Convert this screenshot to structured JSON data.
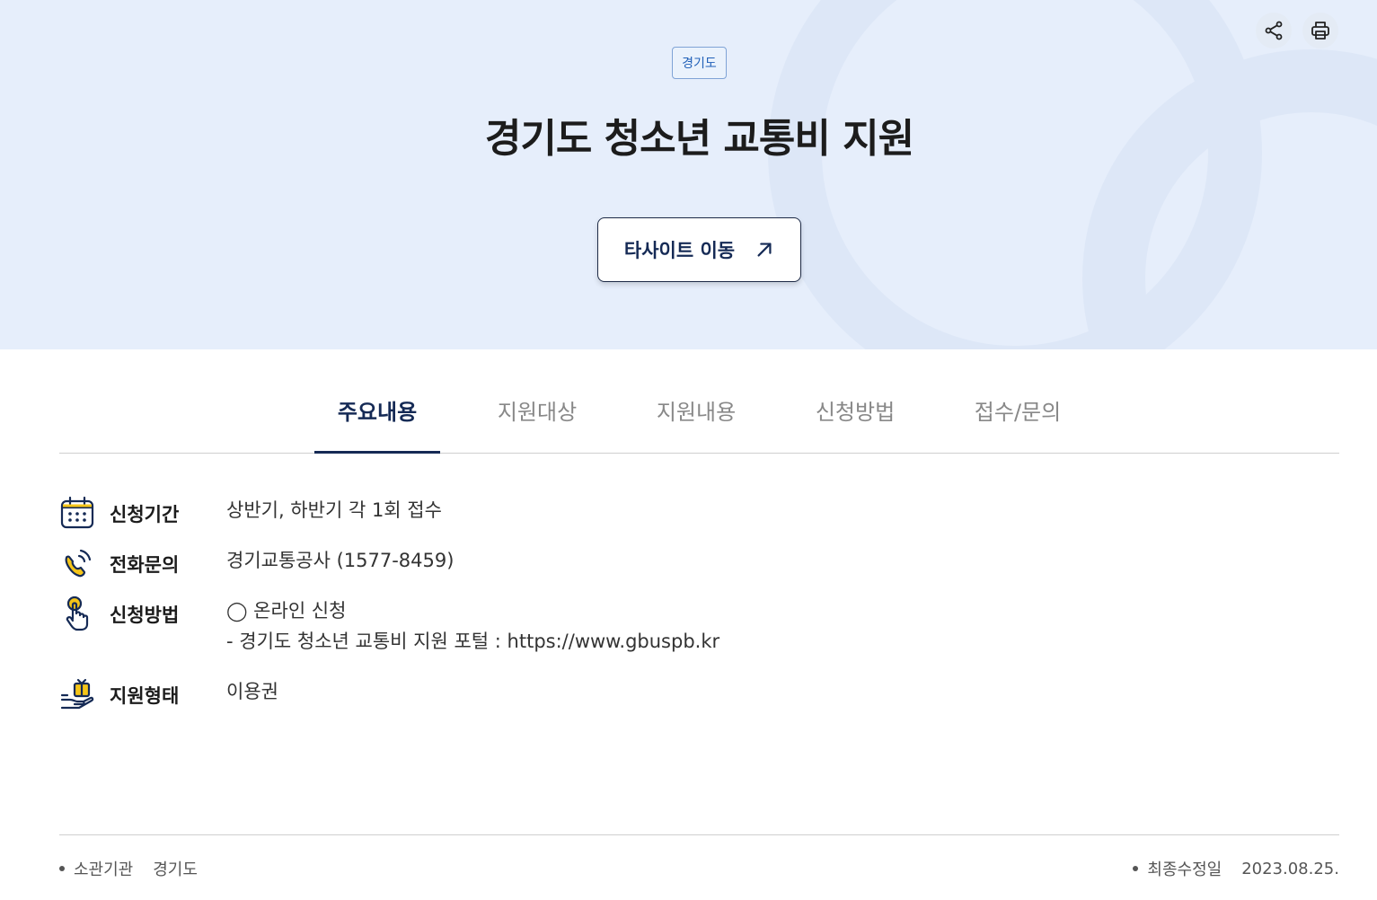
{
  "hero": {
    "region_tag": "경기도",
    "title": "경기도 청소년 교통비 지원",
    "go_button_label": "타사이트 이동"
  },
  "toolbar": {
    "share_icon": "share-icon",
    "print_icon": "print-icon"
  },
  "tabs": [
    {
      "label": "주요내용",
      "active": true
    },
    {
      "label": "지원대상",
      "active": false
    },
    {
      "label": "지원내용",
      "active": false
    },
    {
      "label": "신청방법",
      "active": false
    },
    {
      "label": "접수/문의",
      "active": false
    }
  ],
  "info": {
    "period": {
      "icon": "calendar-icon",
      "label": "신청기간",
      "value": "상반기, 하반기 각 1회 접수"
    },
    "phone": {
      "icon": "phone-icon",
      "label": "전화문의",
      "value": "경기교통공사 (1577-8459)"
    },
    "method": {
      "icon": "hand-click-icon",
      "label": "신청방법",
      "value_line1": "◯ 온라인 신청",
      "value_line2": "- 경기도 청소년 교통비 지원 포털 : https://www.gbuspb.kr"
    },
    "support_type": {
      "icon": "gift-hand-icon",
      "label": "지원형태",
      "value": "이용권"
    }
  },
  "footer": {
    "agency_label": "소관기관",
    "agency_value": "경기도",
    "updated_label": "최종수정일",
    "updated_value": "2023.08.25."
  },
  "colors": {
    "hero_bg": "#e6eefb",
    "accent_navy": "#152a55",
    "tag_blue": "#2060b8",
    "icon_yellow": "#f5c518"
  }
}
